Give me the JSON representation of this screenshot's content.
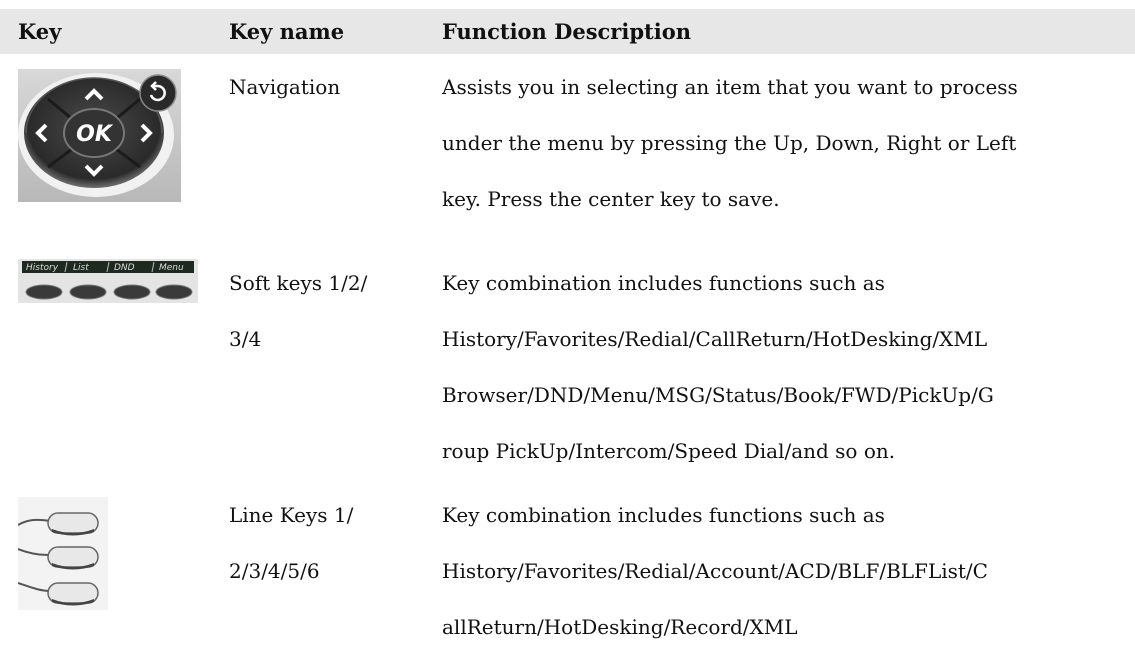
{
  "header": {
    "key": "Key",
    "key_name": "Key name",
    "function": "Function Description"
  },
  "rows": [
    {
      "image_icon": "navigation-keypad-icon",
      "key_name": [
        "Navigation"
      ],
      "description": [
        "Assists you in selecting an item that you want to process",
        "under the menu by pressing the Up, Down, Right or Left",
        "key. Press the center key to save."
      ],
      "image_labels": {
        "ok": "OK"
      }
    },
    {
      "image_icon": "soft-keys-icon",
      "key_name": [
        "Soft keys 1/2/",
        "3/4"
      ],
      "description": [
        "Key combination includes functions such as",
        "History/Favorites/Redial/CallReturn/HotDesking/XML",
        "Browser/DND/Menu/MSG/Status/Book/FWD/PickUp/G",
        "roup PickUp/Intercom/Speed Dial/and so on."
      ],
      "image_labels": [
        "History",
        "List",
        "DND",
        "Menu"
      ]
    },
    {
      "image_icon": "line-keys-icon",
      "key_name": [
        "Line Keys 1/",
        "2/3/4/5/6"
      ],
      "description": [
        "Key combination includes functions such as",
        "History/Favorites/Redial/Account/ACD/BLF/BLFList/C",
        "allReturn/HotDesking/Record/XML"
      ]
    }
  ]
}
